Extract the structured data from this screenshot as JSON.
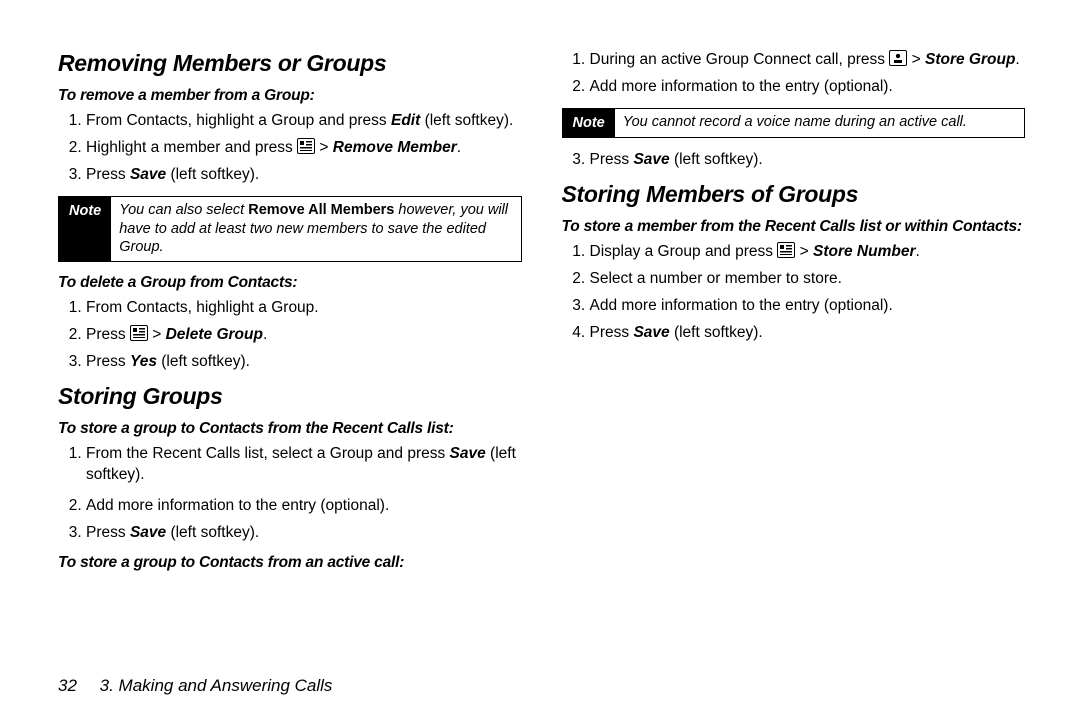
{
  "footer": {
    "page_number": "32",
    "chapter": "3. Making and Answering Calls"
  },
  "note_label": "Note",
  "left": {
    "h2_remove": "Removing Members or Groups",
    "sub_remove": "To remove a member from a Group:",
    "remove_steps": {
      "s1a": "From Contacts, highlight a Group and press ",
      "s1b": "Edit",
      "s1c": " (left softkey).",
      "s2a": "Highlight a member and press ",
      "s2b": " > ",
      "s2c": "Remove Member",
      "s2d": ".",
      "s3a": "Press ",
      "s3b": "Save",
      "s3c": " (left softkey)."
    },
    "note1a": "You can also select ",
    "note1b": "Remove All Members",
    "note1c": " however, you will have to add at least two new members to save the edited Group.",
    "sub_delete": "To delete a Group from Contacts:",
    "delete_steps": {
      "s1": "From Contacts, highlight a Group.",
      "s2a": "Press ",
      "s2b": " > ",
      "s2c": "Delete Group",
      "s2d": ".",
      "s3a": "Press ",
      "s3b": "Yes",
      "s3c": " (left softkey)."
    },
    "h2_storing": "Storing Groups",
    "sub_store_recent": "To store a group to Contacts from the Recent Calls list:",
    "store_recent_steps": {
      "s1a": "From the Recent Calls list, select a Group and press ",
      "s1b": "Save",
      "s1c": " (left softkey)."
    }
  },
  "right": {
    "cont_steps": {
      "s2": "Add more information to the entry (optional).",
      "s3a": "Press ",
      "s3b": "Save",
      "s3c": " (left softkey)."
    },
    "sub_store_active": "To store a group to Contacts from an active call:",
    "active_steps": {
      "s1a": "During an active Group Connect call, press ",
      "s1b": " > ",
      "s1c": "Store Group",
      "s1d": ".",
      "s2": "Add more information to the entry (optional).",
      "s3a": "Press ",
      "s3b": "Save",
      "s3c": " (left softkey)."
    },
    "note2": "You cannot record a voice name during an active call.",
    "h2_members": "Storing Members of Groups",
    "sub_store_member": "To store a member from the Recent Calls list or within Contacts:",
    "member_steps": {
      "s1a": "Display a Group and press ",
      "s1b": " > ",
      "s1c": "Store Number",
      "s1d": ".",
      "s2": "Select a number or member to store.",
      "s3": "Add more information to the entry (optional).",
      "s4a": "Press ",
      "s4b": "Save",
      "s4c": " (left softkey)."
    }
  }
}
